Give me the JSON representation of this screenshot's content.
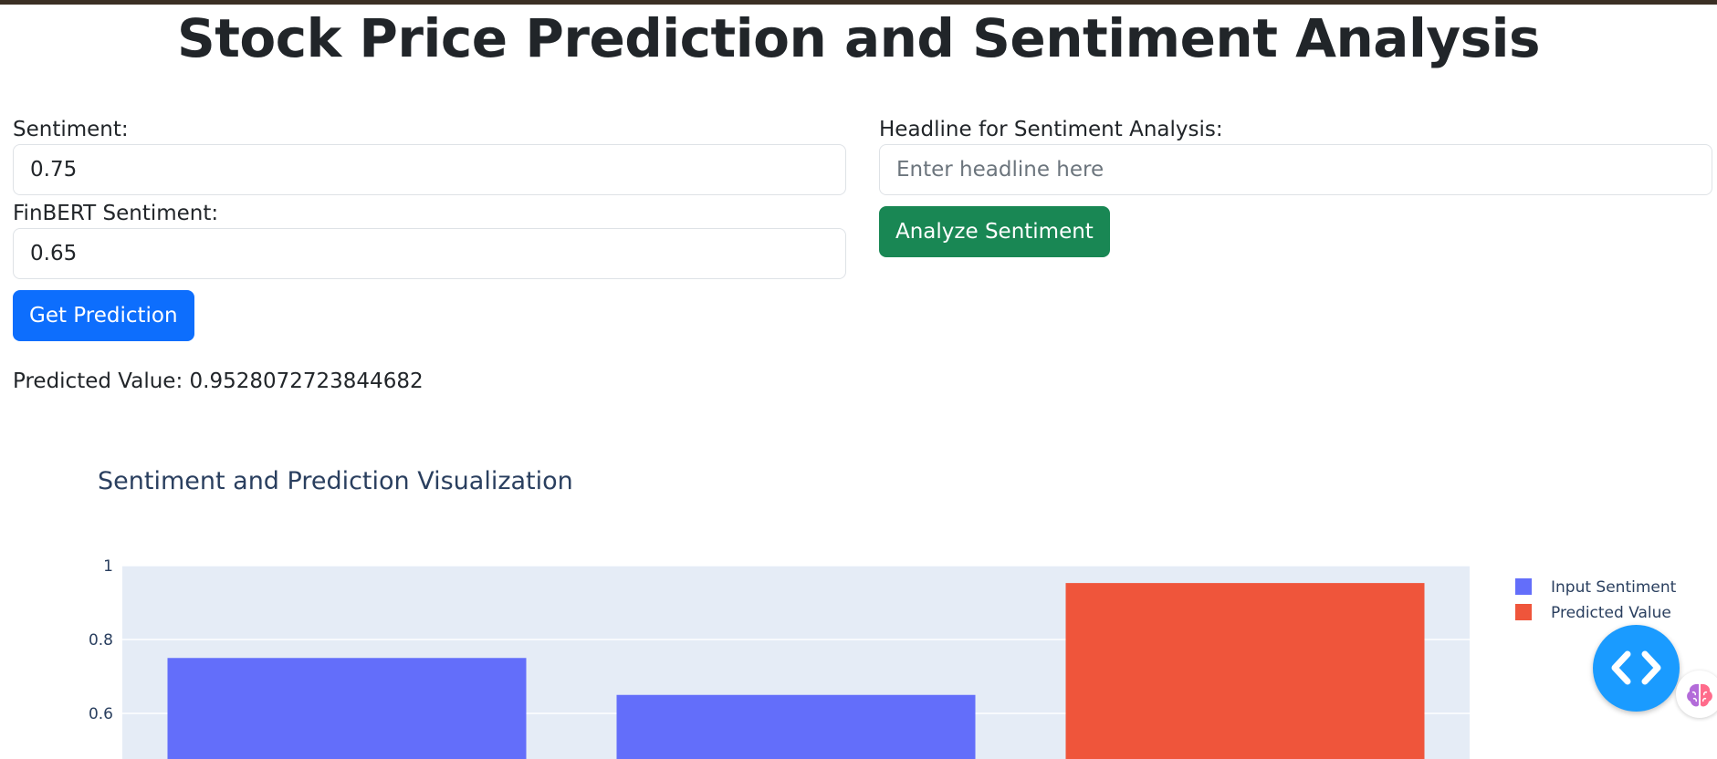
{
  "page": {
    "title": "Stock Price Prediction and Sentiment Analysis"
  },
  "form": {
    "sentiment_label": "Sentiment:",
    "sentiment_value": "0.75",
    "finbert_label": "FinBERT Sentiment:",
    "finbert_value": "0.65",
    "predict_button": "Get Prediction",
    "headline_label": "Headline for Sentiment Analysis:",
    "headline_placeholder": "Enter headline here",
    "headline_value": "",
    "analyze_button": "Analyze Sentiment"
  },
  "result": {
    "label": "Predicted Value: ",
    "value": "0.9528072723844682"
  },
  "colors": {
    "input_series": "#636efa",
    "predicted_series": "#ef553b",
    "plot_bg": "#e5ecf6",
    "primary_button": "#0d6efd",
    "success_button": "#198754",
    "fab": "#1a9bff"
  },
  "icons": {
    "fab": "code-brackets-icon",
    "extension": "brain-icon"
  },
  "chart_data": {
    "type": "bar",
    "title": "Sentiment and Prediction Visualization",
    "xlabel": "",
    "ylabel": "",
    "ylim": [
      0.5,
      1.0
    ],
    "yticks": [
      0.6,
      0.8,
      1
    ],
    "ytick_labels": [
      "0.6",
      "0.8",
      "1"
    ],
    "grid": true,
    "legend_position": "top-right",
    "series": [
      {
        "name": "Input Sentiment",
        "color": "#636efa",
        "bars": [
          {
            "slot": 0,
            "value": 0.75
          },
          {
            "slot": 1,
            "value": 0.65
          }
        ]
      },
      {
        "name": "Predicted Value",
        "color": "#ef553b",
        "bars": [
          {
            "slot": 2,
            "value": 0.9528072723844682
          }
        ]
      }
    ]
  }
}
